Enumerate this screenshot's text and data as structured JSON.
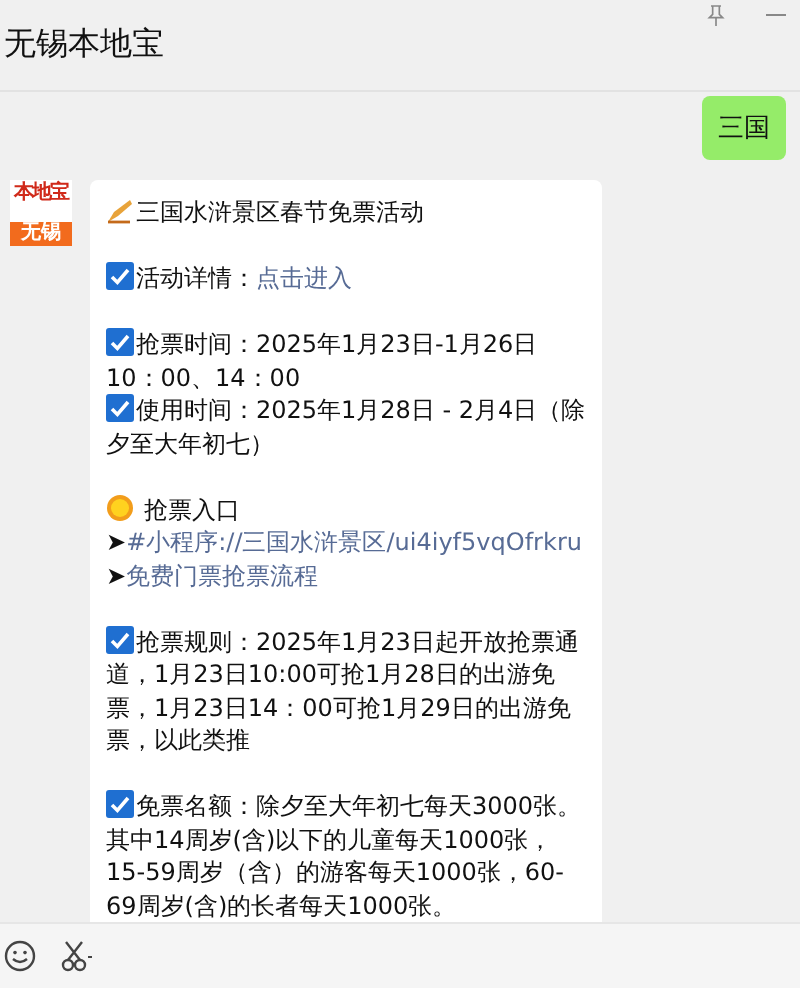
{
  "window": {
    "title": "无锡本地宝"
  },
  "sent_message": {
    "text": "三国"
  },
  "avatar": {
    "brand": "本地宝",
    "city": "无锡"
  },
  "message": {
    "blocks": [
      {
        "lines": [
          {
            "kind": "writing",
            "parts": [
              {
                "text": "三国水浒景区春节免票活动",
                "link": false
              }
            ]
          }
        ]
      },
      {
        "lines": [
          {
            "kind": "check",
            "parts": [
              {
                "text": "活动详情：",
                "link": false
              },
              {
                "text": "点击进入",
                "link": true
              }
            ]
          }
        ]
      },
      {
        "lines": [
          {
            "kind": "check",
            "parts": [
              {
                "text": "抢票时间：2025年1月23日-1月26日 10：00、14：00",
                "link": false
              }
            ]
          },
          {
            "kind": "check",
            "parts": [
              {
                "text": "使用时间：2025年1月28日 - 2月4日（除夕至大年初七）",
                "link": false
              }
            ]
          }
        ]
      },
      {
        "lines": [
          {
            "kind": "sun",
            "parts": [
              {
                "text": " 抢票入口➤",
                "link": false
              },
              {
                "text": "#小程序://三国水浒景区/",
                "link": true
              },
              {
                "text": "ui4iyf5vqOfrkru",
                "link": true
              }
            ]
          },
          {
            "kind": "plain",
            "parts": [
              {
                "text": "➤",
                "link": false
              },
              {
                "text": "免费门票抢票流程",
                "link": true
              }
            ]
          }
        ]
      },
      {
        "lines": [
          {
            "kind": "check",
            "parts": [
              {
                "text": "抢票规则：2025年1月23日起开放抢票通道，1月23日10:00可抢1月28日的出游免票，1月23日14：00可抢1月29日的出游免票，以此类推",
                "link": false
              }
            ]
          }
        ]
      },
      {
        "lines": [
          {
            "kind": "check",
            "parts": [
              {
                "text": "免票名额：除夕至大年初七每天3000张。其中14周岁(含)以下的儿童每天1000张，15-59周岁（含）的游客每天1000张，60-69周岁(含)的长者每天1000张。",
                "link": false
              }
            ]
          }
        ]
      }
    ]
  }
}
